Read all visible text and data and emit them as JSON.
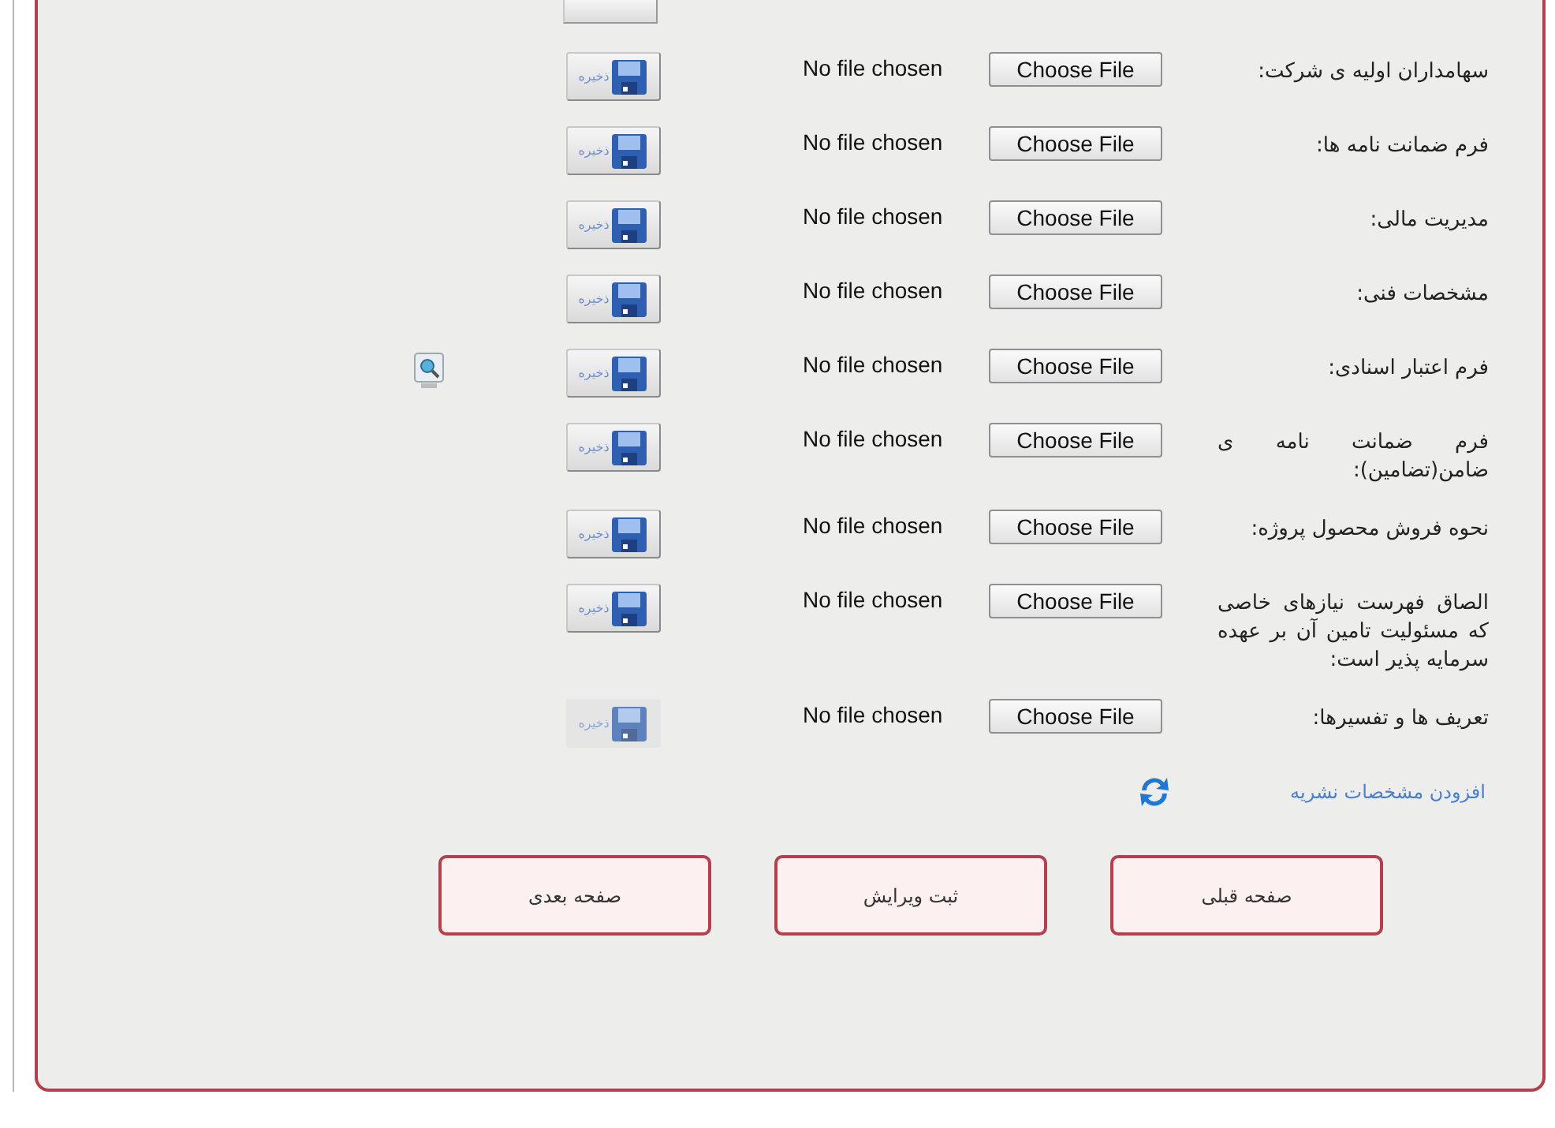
{
  "rows": [
    {
      "label": "سهامداران اولیه ی شرکت:",
      "file_status": "No file chosen",
      "choose_button": "Choose File",
      "save_button": "ذخیره",
      "save_disabled": false,
      "preview": false
    },
    {
      "label": "فرم ضمانت نامه ها:",
      "file_status": "No file chosen",
      "choose_button": "Choose File",
      "save_button": "ذخیره",
      "save_disabled": false,
      "preview": false
    },
    {
      "label": "مدیریت مالی:",
      "file_status": "No file chosen",
      "choose_button": "Choose File",
      "save_button": "ذخیره",
      "save_disabled": false,
      "preview": false
    },
    {
      "label": "مشخصات فنی:",
      "file_status": "No file chosen",
      "choose_button": "Choose File",
      "save_button": "ذخیره",
      "save_disabled": false,
      "preview": false
    },
    {
      "label": "فرم اعتبار اسنادی:",
      "file_status": "No file chosen",
      "choose_button": "Choose File",
      "save_button": "ذخیره",
      "save_disabled": false,
      "preview": true
    },
    {
      "label": "فرم ضمانت نامه ی ضامن(تضامین):",
      "file_status": "No file chosen",
      "choose_button": "Choose File",
      "save_button": "ذخیره",
      "save_disabled": false,
      "preview": false
    },
    {
      "label": "نحوه فروش محصول پروژه:",
      "file_status": "No file chosen",
      "choose_button": "Choose File",
      "save_button": "ذخیره",
      "save_disabled": false,
      "preview": false
    },
    {
      "label": "الصاق فهرست نیازهای خاصی که مسئولیت تامین آن بر عهده سرمایه پذیر است:",
      "file_status": "No file chosen",
      "choose_button": "Choose File",
      "save_button": "ذخیره",
      "save_disabled": false,
      "preview": false
    },
    {
      "label": "تعریف ها و تفسیرها:",
      "file_status": "No file chosen",
      "choose_button": "Choose File",
      "save_button": "ذخیره",
      "save_disabled": true,
      "preview": false
    }
  ],
  "add_link": "افزودن مشخصات نشریه",
  "nav_buttons": [
    "صفحه قبلی",
    "ثبت ویرایش",
    "صفحه بعدی"
  ]
}
